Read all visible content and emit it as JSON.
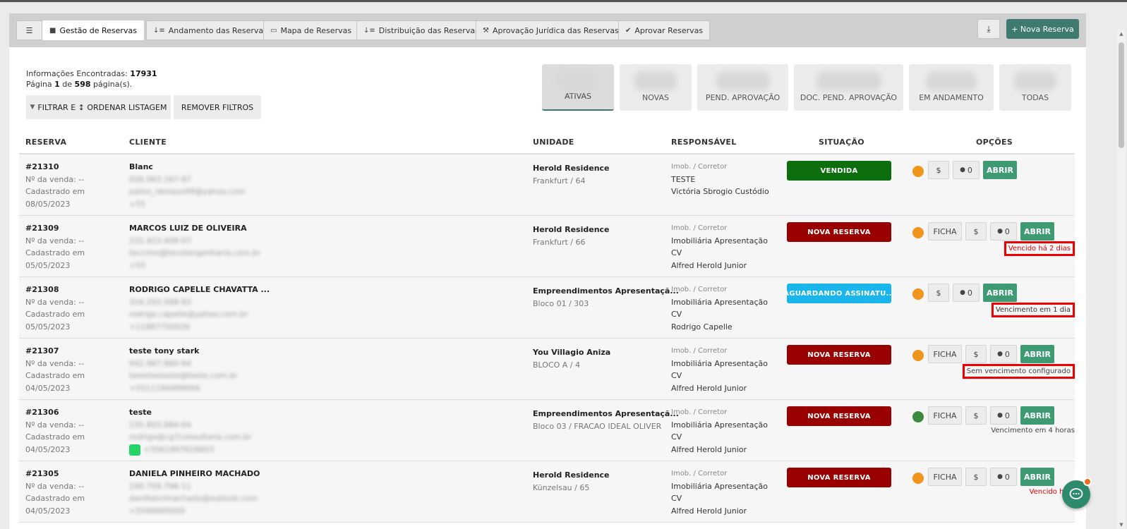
{
  "tabs": [
    {
      "label": "Gestão de Reservas",
      "icon": "bookmark-icon",
      "active": true
    },
    {
      "label": "Andamento das Reservas",
      "icon": "sort-icon"
    },
    {
      "label": "Mapa de Reservas",
      "icon": "map-icon"
    },
    {
      "label": "Distribuição das Reservas",
      "icon": "sort-icon"
    },
    {
      "label": "Aprovação Jurídica das Reservas",
      "icon": "gavel-icon"
    },
    {
      "label": "Aprovar Reservas",
      "icon": "check-icon"
    }
  ],
  "menu_icon": "☰",
  "download_icon": "⤓",
  "new_button": "+ Nova Reserva",
  "info": {
    "found_label": "Informações Encontradas:",
    "found_value": "17931",
    "page_label": "Página",
    "page_current": "1",
    "page_of": "de",
    "page_total": "598",
    "page_suffix": "página(s)."
  },
  "filter_button": "FILTRAR E ↕ ORDENAR LISTAGEM",
  "remove_filters": "REMOVER FILTROS",
  "stat_tabs": [
    "ATIVAS",
    "NOVAS",
    "PEND. APROVAÇÃO",
    "DOC. PEND. APROVAÇÃO",
    "EM ANDAMENTO",
    "TODAS"
  ],
  "headers": {
    "reserva": "RESERVA",
    "cliente": "CLIENTE",
    "unidade": "UNIDADE",
    "responsavel": "RESPONSÁVEL",
    "situacao": "SITUAÇÃO",
    "opcoes": "OPÇÕES"
  },
  "rows": [
    {
      "id": "#21310",
      "venda": "Nº da venda: --",
      "cadastrado": "Cadastrado em",
      "date": "08/05/2023",
      "client": "Blanc",
      "client_blur": [
        "026.063.167-97",
        "paliss_nkolaus99@yahoo.com",
        "+55"
      ],
      "unit": "Herold Residence",
      "unit_sub": "Frankfurt / 64",
      "resp_label": "Imob. / Corretor",
      "resp": [
        "TESTE",
        "Victória Sbrogio Custódio"
      ],
      "status": "VENDIDA",
      "status_color": "#0d6e0d",
      "dot_color": "#f0941c",
      "ficha": "",
      "comments": "0",
      "abrir": "ABRIR",
      "venc": "",
      "venc_color": "",
      "venc_box": false
    },
    {
      "id": "#21309",
      "venda": "Nº da venda: --",
      "cadastrado": "Cadastrado em",
      "date": "05/05/2023",
      "client": "MARCOS LUIZ DE OLIVEIRA",
      "client_blur": [
        "231.423.408-07",
        "teccimo@tecolengenharia.com.br",
        "+55"
      ],
      "unit": "Herold Residence",
      "unit_sub": "Frankfurt / 66",
      "resp_label": "Imob. / Corretor",
      "resp": [
        "Imobiliária Apresentação",
        "CV",
        "Alfred Herold Junior"
      ],
      "status": "NOVA RESERVA",
      "status_color": "#990000",
      "dot_color": "#f0941c",
      "ficha": "FICHA",
      "comments": "0",
      "abrir": "ABRIR",
      "venc": "Vencido há 2 dias",
      "venc_color": "#e00000",
      "venc_box": true
    },
    {
      "id": "#21308",
      "venda": "Nº da venda: --",
      "cadastrado": "Cadastrado em",
      "date": "05/05/2023",
      "client": "RODRIGO CAPELLE CHAVATTA ...",
      "client_blur": [
        "316.293.098-93",
        "rodrigo.capelle@yahoo.com.br",
        "+11987750026"
      ],
      "unit": "Empreendimentos Apresentaçã...",
      "unit_sub": "Bloco 01 / 303",
      "resp_label": "Imob. / Corretor",
      "resp": [
        "Imobiliária Apresentação",
        "CV",
        "Rodrigo Capelle"
      ],
      "status": "AGUARDANDO ASSINATU...",
      "status_color": "#1ab5ea",
      "dot_color": "#f0941c",
      "ficha": "",
      "comments": "0",
      "abrir": "ABRIR",
      "venc": "Vencimento em 1 dia",
      "venc_color": "#333333",
      "venc_box": true
    },
    {
      "id": "#21307",
      "venda": "Nº da venda: --",
      "cadastrado": "Cadastrado em",
      "date": "04/05/2023",
      "client": "teste tony stark",
      "client_blur": [
        "942.967.860-94",
        "testetesteste@teste.com.br",
        "+5511194499094"
      ],
      "unit": "You Villagio Aniza",
      "unit_sub": "BLOCO A / 4",
      "resp_label": "Imob. / Corretor",
      "resp": [
        "Imobiliária Apresentação",
        "CV",
        "Alfred Herold Junior"
      ],
      "status": "NOVA RESERVA",
      "status_color": "#990000",
      "dot_color": "#f0941c",
      "ficha": "FICHA",
      "comments": "0",
      "abrir": "ABRIR",
      "venc": "Sem vencimento configurado",
      "venc_color": "#444444",
      "venc_box": true
    },
    {
      "id": "#21306",
      "venda": "Nº da venda: --",
      "cadastrado": "Cadastrado em",
      "date": "04/05/2023",
      "client": "teste",
      "client_blur": [
        "235.803.884-04",
        "rodrigo@cg7consultoria.com.br",
        "+5561997616603"
      ],
      "unit": "Empreendimentos Apresentaçã...",
      "unit_sub": "Bloco 03 / FRACAO IDEAL OLIVER",
      "resp_label": "Imob. / Corretor",
      "resp": [
        "Imobiliária Apresentação",
        "CV",
        "Alfred Herold Junior"
      ],
      "status": "NOVA RESERVA",
      "status_color": "#990000",
      "dot_color": "#3c8a3c",
      "ficha": "FICHA",
      "comments": "0",
      "abrir": "ABRIR",
      "venc": "Vencimento em 4 horas",
      "venc_color": "#444444",
      "venc_box": false,
      "whatsapp": true
    },
    {
      "id": "#21305",
      "venda": "Nº da venda: --",
      "cadastrado": "Cadastrado em",
      "date": "04/05/2023",
      "client": "DANIELA PINHEIRO MACHADO",
      "client_blur": [
        "190.759.796-11",
        "danihenrimachado@outlook.com",
        "+5599995000"
      ],
      "unit": "Herold Residence",
      "unit_sub": "Künzelsau / 65",
      "resp_label": "Imob. / Corretor",
      "resp": [
        "Imobiliária Apresentação",
        "CV",
        "Alfred Herold Junior"
      ],
      "status": "NOVA RESERVA",
      "status_color": "#990000",
      "dot_color": "#f0941c",
      "ficha": "FICHA",
      "comments": "0",
      "abrir": "ABRIR",
      "venc": "Vencido há 3",
      "venc_color": "#e00000",
      "venc_box": false
    }
  ]
}
